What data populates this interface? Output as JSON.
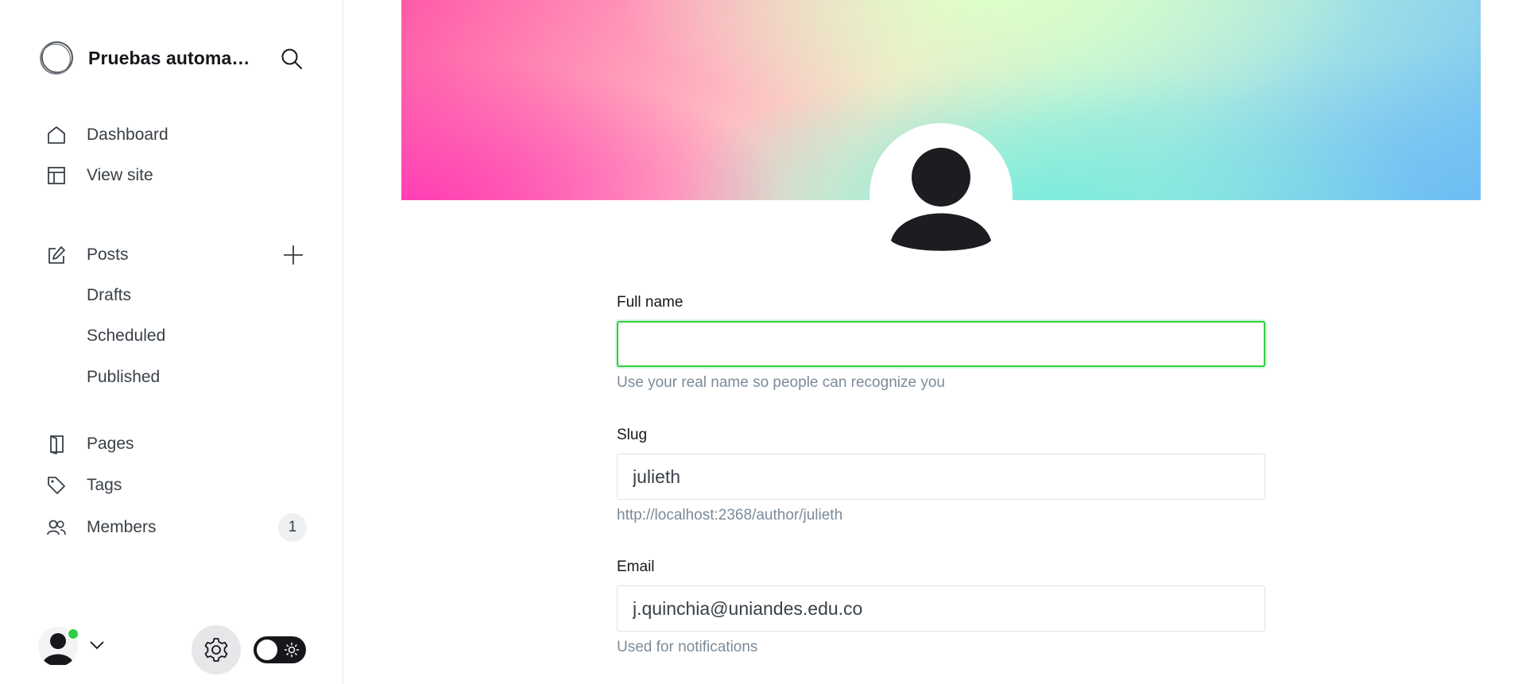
{
  "sidebar": {
    "site_title": "Pruebas automatizadas",
    "nav": {
      "dashboard": "Dashboard",
      "view_site": "View site",
      "posts": "Posts",
      "drafts": "Drafts",
      "scheduled": "Scheduled",
      "published": "Published",
      "pages": "Pages",
      "tags": "Tags",
      "members": "Members",
      "members_count": "1"
    },
    "user_status_color": "#30cf43"
  },
  "profile": {
    "full_name": {
      "label": "Full name",
      "value": "",
      "hint": "Use your real name so people can recognize you"
    },
    "slug": {
      "label": "Slug",
      "value": "julieth",
      "hint": "http://localhost:2368/author/julieth"
    },
    "email": {
      "label": "Email",
      "value": "j.quinchia@uniandes.edu.co",
      "hint": "Used for notifications"
    }
  },
  "colors": {
    "accent": "#30cf43",
    "text": "#15171a",
    "muted": "#7c8b9a"
  }
}
